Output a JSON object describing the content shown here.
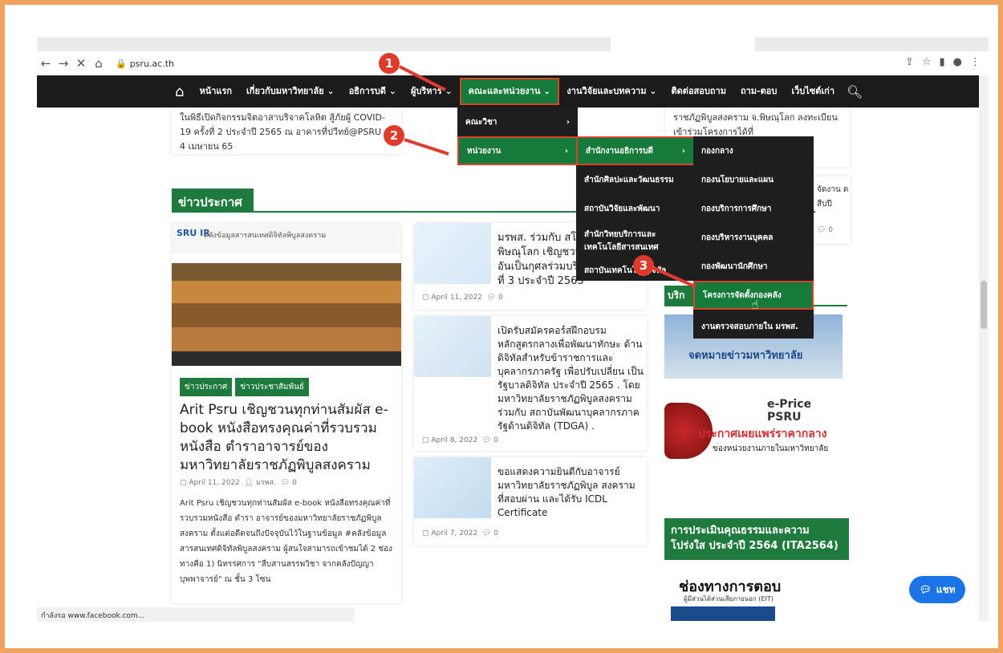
{
  "browser": {
    "url": "psru.ac.th",
    "status": "กำลังรอ www.facebook.com..."
  },
  "nav": {
    "items": [
      "หน้าแรก",
      "เกี่ยวกับมหาวิทยาลัย ⌄",
      "อธิการบดี ⌄",
      "ผู้บริหาร ⌄",
      "คณะและหน่วยงาน ⌄",
      "งานวิจัยและบทความ ⌄",
      "ติดต่อสอบถาม",
      "ถาม-ตอบ",
      "เว็บไซต์เก่า"
    ]
  },
  "menus": {
    "level1": [
      "คณะวิชา",
      "หน่วยงาน"
    ],
    "level2": [
      "สำนักงานอธิการบดี",
      "สำนักศิลปะและวัฒนธรรม",
      "สถาบันวิจัยและพัฒนา",
      "สำนักวิทยบริการและเทคโนโลยีสารสนเทศ",
      "สถาบันเทคโนโลยีดิจิทัล"
    ],
    "level3": [
      "กองกลาง",
      "กองนโยบายและแผน",
      "กองบริการการศึกษา",
      "กองบริหารงานบุคคล",
      "กองพัฒนานักศึกษา",
      "โครงการจัดตั้งกองคลัง",
      "งานตรวจสอบภายใน มรพส."
    ]
  },
  "badges": [
    "1",
    "2",
    "3"
  ],
  "top_cards": {
    "left_text": "ในพิธีเปิดกิจกรรมจิตอาสาบริจาคโลหิต สู้ภัยผู้ COVID-19 ครั้งที่ 2 ประจำปี 2565 ณ อาคารที่ปวีทย์@PSRU ( 4 เมษายน 65",
    "right_text": "ราชภัฏพิบูลสงคราม จ.พิษณุโลก ลงทะเบียนเข้าร่วมโครงการได้ที่"
  },
  "section_title": "ข่าวประกาศ",
  "featured": {
    "image_caption": "คลังข้อมูลสารสนเทศดิจิทัลพิบูลสงคราม",
    "logo": "SRU IR",
    "tags": [
      "ข่าวประกาศ",
      "ข่าวประชาสัมพันธ์"
    ],
    "title": "Arit Psru เชิญชวนทุกท่านสัมผัส e-book หนังสือทรงคุณค่าที่รวบรวมหนังสือ ตำราอาจารย์ของมหาวิทยาลัยราชภัฏพิบูลสงคราม",
    "date": "April 11, 2022",
    "author": "มรพส.",
    "comments": "0",
    "excerpt": "Arit Psru เชิญชวนทุกท่านสัมผัส e-book หนังสือทรงคุณค่าที่รวบรวมหนังสือ ตำรา อาจารย์ของมหาวิทยาลัยราชภัฏพิบูลสงคราม ตั้งแต่อดีตจนถึงปัจจุบันไว้ในฐานข้อมูล #คลังข้อมูลสารสนเทศดิจิทัลพิบูลสงคราม ผู้สนใจสามารถเข้าชมได้ 2 ช่องทางคือ 1) นิทรรศการ \"สืบสานสรรพวิชา จากคลังปัญญาบุพพาจารย์\" ณ ชั้น 3 โซน"
  },
  "news": [
    {
      "title": "มรพส. ร่วมกับ สโม พิษณุโลก เชิญชวน อันเป็นกุศลร่วมบริ ที่ 3 ประจำปี 2565",
      "date": "April 11, 2022",
      "comments": "0"
    },
    {
      "title": "เปิดรับสมัครคอร์สฝึกอบรม หลักสูตรกลางเพื่อพัฒนาทักษะ ด้านดิจิทัลสำหรับข้าราชการและ บุคลากรภาครัฐ เพื่อปรับเปลี่ยน เป็นรัฐบาลดิจิทัล ประจำปี 2565 . โดย มหาวิทยาลัยราชภัฏพิบูลสงคราม ร่วมกับ สถาบันพัฒนาบุคลากรภาครัฐด้านดิจิทัล (TDGA) .",
      "date": "April 8, 2022",
      "comments": "0"
    },
    {
      "title": "ขอแสดงความยินดีกับอาจารย์ มหาวิทยาลัยราชภัฏพิบูล สงคราม ที่สอบผ่าน และได้รับ ICDL Certificate",
      "date": "April 7, 2022",
      "comments": "0"
    }
  ],
  "right_col": {
    "side_text": "จัดงาน ตสืบปี",
    "comments": "0",
    "partial_heading": "บริก",
    "banner_text": "จดหมายข่าวมหาวิทยาลัย",
    "eprice_title": "e-Price PSRU",
    "eprice_sub": "ประกาศเผยแพร่ราคากลาง",
    "eprice_sub2": "ของหน่วยงานภายในมหาวิทยาลัย",
    "ita_title": "การประเมินคุณธรรมและความโปร่งใส ประจำปี 2564 (ITA2564)",
    "ita_sub": "ช่องทางการตอบ",
    "ita_sub2": "ผู้มีส่วนได้ส่วนเสียภายนอก (EIT)"
  },
  "chat": {
    "label": "แชท"
  }
}
